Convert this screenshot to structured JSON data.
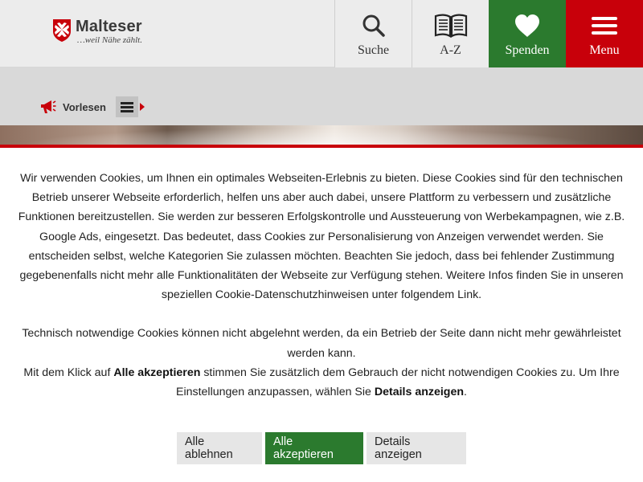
{
  "header": {
    "logo": {
      "name": "Malteser",
      "tagline": "…weil Nähe zählt.",
      "cross_color": "#c8000a"
    },
    "nav": {
      "search_label": "Suche",
      "az_label": "A-Z",
      "donate_label": "Spenden",
      "menu_label": "Menu"
    },
    "colors": {
      "donate_bg": "#2b7a2e",
      "menu_bg": "#c8000a"
    }
  },
  "readbar": {
    "label": "Vorlesen"
  },
  "cookie": {
    "paragraph1": "Wir verwenden Cookies, um Ihnen ein optimales Webseiten-Erlebnis zu bieten. Diese Cookies sind für den technischen Betrieb unserer Webseite erforderlich, helfen uns aber auch dabei, unsere Plattform zu verbessern und zusätzliche Funktionen bereitzustellen. Sie werden zur besseren Erfolgskontrolle und Aussteuerung von Werbekampagnen, wie z.B. Google Ads, eingesetzt. Das bedeutet, dass Cookies zur Personalisierung von Anzeigen verwendet werden. Sie entscheiden selbst, welche Kategorien Sie zulassen möchten. Beachten Sie jedoch, dass bei fehlender Zustimmung gegebenenfalls nicht mehr alle Funktionalitäten der Webseite zur Verfügung stehen. Weitere Infos finden Sie in unseren speziellen Cookie-Datenschutzhinweisen unter folgendem Link.",
    "paragraph2": "Technisch notwendige Cookies können nicht abgelehnt werden, da ein Betrieb der Seite dann nicht mehr gewährleistet werden kann.",
    "line3_pre": "Mit dem Klick auf ",
    "line3_bold1": "Alle akzeptieren",
    "line3_mid": " stimmen Sie zusätzlich dem Gebrauch der nicht notwendigen Cookies zu. Um Ihre Einstellungen anzupassen, wählen Sie ",
    "line3_bold2": "Details anzeigen",
    "line3_post": ".",
    "buttons": {
      "reject": "Alle ablehnen",
      "accept": "Alle akzeptieren",
      "details": "Details anzeigen"
    },
    "accent_color": "#c8000a",
    "accept_color": "#2b7a2e"
  },
  "icons": {
    "logo": "maltese-cross-icon",
    "search": "search-icon",
    "az": "book-icon",
    "donate": "heart-icon",
    "menu": "hamburger-icon",
    "readaloud": "megaphone-icon",
    "readaloud_menu": "list-icon"
  }
}
